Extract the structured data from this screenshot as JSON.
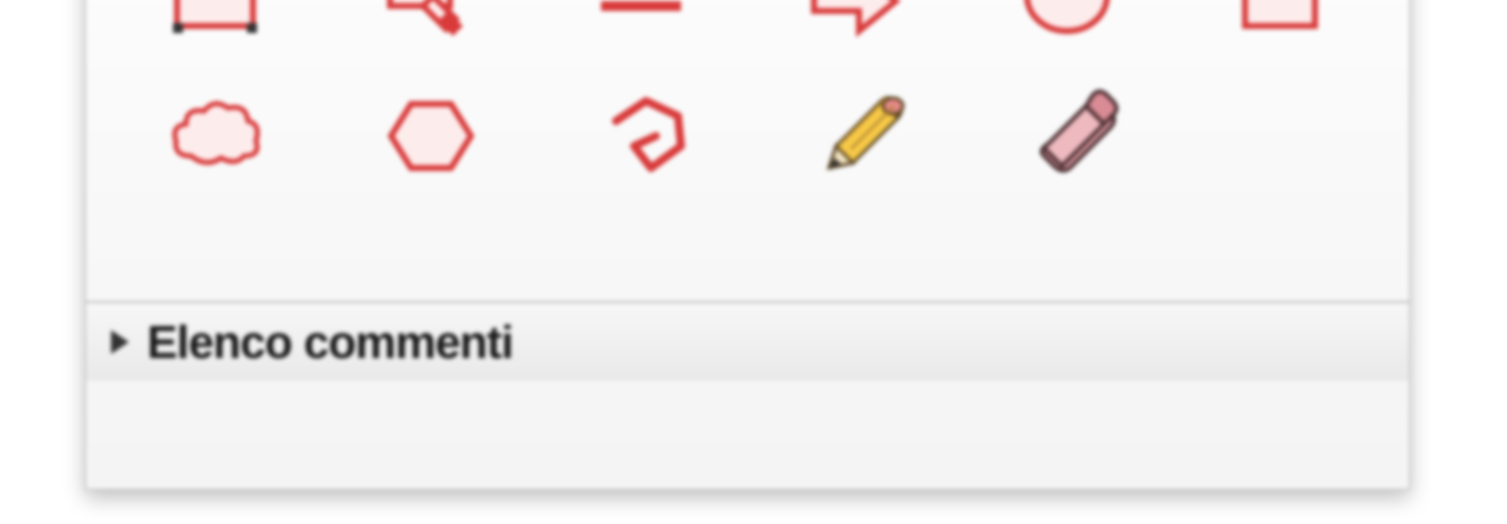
{
  "toolbar": {
    "row1": [
      {
        "name": "text-box-icon"
      },
      {
        "name": "stamp-icon"
      },
      {
        "name": "line-icon"
      },
      {
        "name": "arrow-icon"
      },
      {
        "name": "circle-icon"
      },
      {
        "name": "rectangle-icon"
      }
    ],
    "row2": [
      {
        "name": "cloud-icon"
      },
      {
        "name": "hexagon-icon"
      },
      {
        "name": "polygon-open-icon"
      },
      {
        "name": "pencil-icon"
      },
      {
        "name": "eraser-icon"
      }
    ]
  },
  "panel": {
    "comments_label": "Elenco commenti"
  }
}
